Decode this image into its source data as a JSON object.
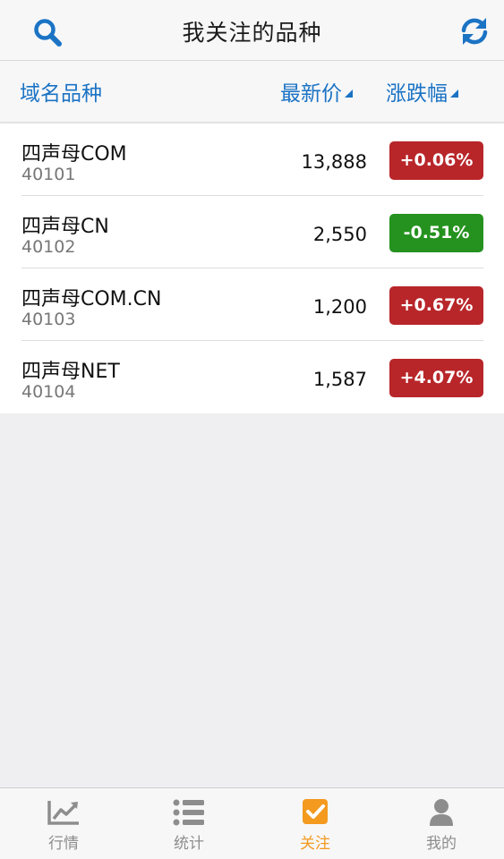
{
  "header": {
    "title": "我关注的品种",
    "search_icon": "search-icon",
    "refresh_icon": "refresh-icon"
  },
  "columns": {
    "name": "域名品种",
    "price": "最新价",
    "change": "涨跌幅",
    "sort_icon": "sort-triangle-icon"
  },
  "colors": {
    "accent": "#1b73c4",
    "up": "#b8262a",
    "down": "#25921f",
    "active_tab": "#f39a1f",
    "inactive_tab": "#8d8d8d"
  },
  "rows": [
    {
      "name": "四声母COM",
      "code": "40101",
      "price": "13,888",
      "change": "+0.06%",
      "direction": "up"
    },
    {
      "name": "四声母CN",
      "code": "40102",
      "price": "2,550",
      "change": "-0.51%",
      "direction": "down"
    },
    {
      "name": "四声母COM.CN",
      "code": "40103",
      "price": "1,200",
      "change": "+0.67%",
      "direction": "up"
    },
    {
      "name": "四声母NET",
      "code": "40104",
      "price": "1,587",
      "change": "+4.07%",
      "direction": "up"
    }
  ],
  "tabs": [
    {
      "label": "行情",
      "icon": "line-chart-icon",
      "active": false
    },
    {
      "label": "统计",
      "icon": "list-icon",
      "active": false
    },
    {
      "label": "关注",
      "icon": "checkbox-icon",
      "active": true
    },
    {
      "label": "我的",
      "icon": "user-icon",
      "active": false
    }
  ]
}
